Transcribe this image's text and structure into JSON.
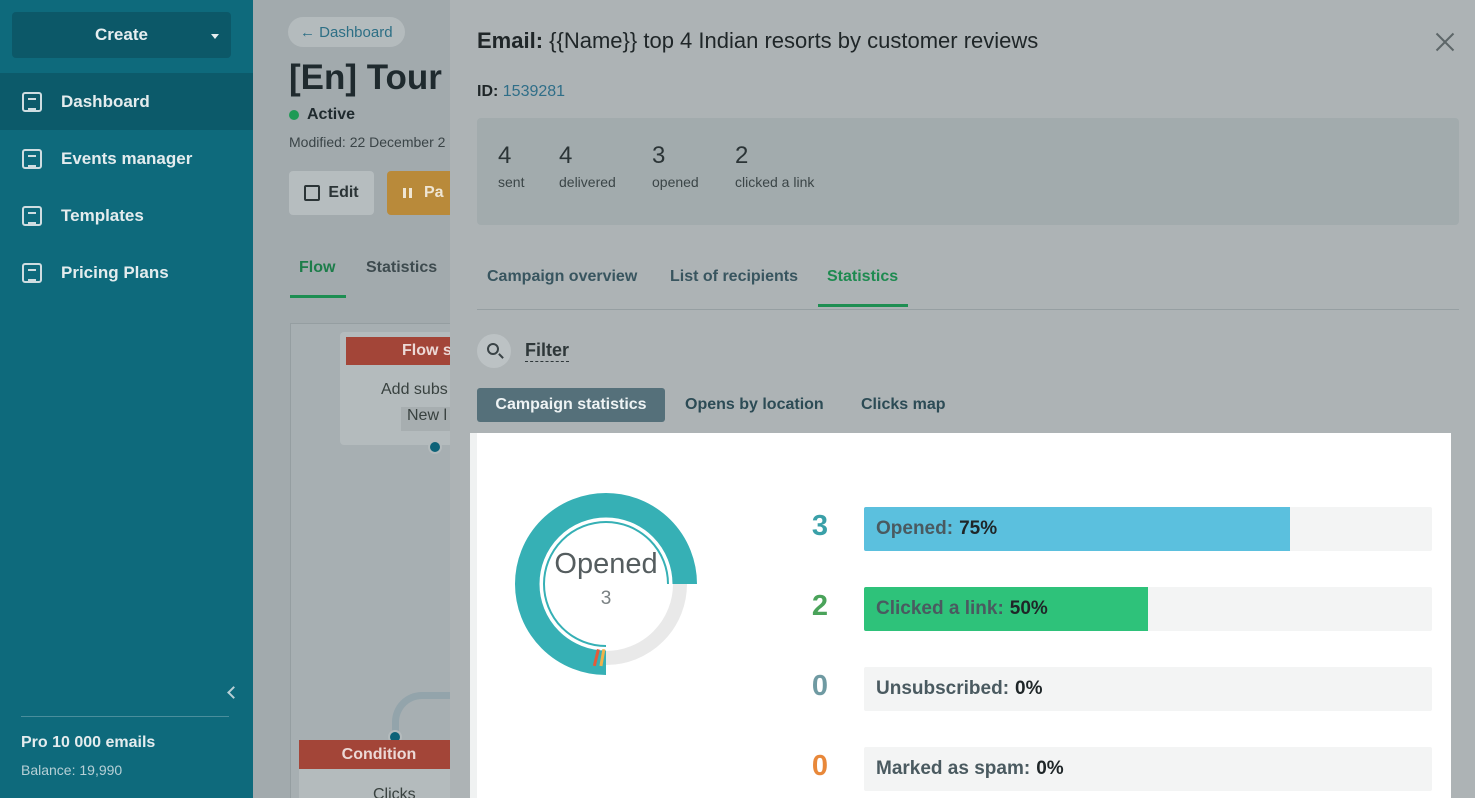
{
  "sidebar": {
    "create_label": "Create",
    "items": [
      {
        "label": "Dashboard",
        "icon": "dashboard-icon"
      },
      {
        "label": "Events manager",
        "icon": "events-icon"
      },
      {
        "label": "Templates",
        "icon": "templates-icon"
      },
      {
        "label": "Pricing Plans",
        "icon": "pricing-icon"
      }
    ],
    "plan": "Pro 10 000 emails",
    "balance": "Balance: 19,990"
  },
  "background_page": {
    "back_link": "← Dashboard",
    "title": "[En] Tour",
    "status": "Active",
    "modified": "Modified: 22 December 2",
    "edit_label": "Edit",
    "pause_label": "Pa",
    "tabs": [
      "Flow",
      "Statistics"
    ],
    "flow": {
      "card_header": "Flow s",
      "card_text": "Add subs",
      "card_tag": "New l",
      "condition_header": "Condition",
      "condition_text": "Clicks"
    }
  },
  "modal": {
    "title_prefix": "Email:",
    "title": "{{Name}} top 4 Indian resorts by customer reviews",
    "id_label": "ID:",
    "id_value": "1539281",
    "summary": [
      {
        "value": "4",
        "label": "sent"
      },
      {
        "value": "4",
        "label": "delivered"
      },
      {
        "value": "3",
        "label": "opened"
      },
      {
        "value": "2",
        "label": "clicked a link"
      }
    ],
    "tabs": [
      "Campaign overview",
      "List of recipients",
      "Statistics"
    ],
    "active_tab": "Statistics",
    "filter_label": "Filter",
    "sub_tabs": [
      "Campaign statistics",
      "Opens by location",
      "Clicks map"
    ],
    "donut": {
      "title": "Opened",
      "value": "3",
      "fraction": 0.75
    },
    "stats": [
      {
        "count": "3",
        "label": "Opened:",
        "percent": "75%",
        "fraction": 0.75,
        "color": "#5bc0de",
        "num_color": "#3aa0a8"
      },
      {
        "count": "2",
        "label": "Clicked a link:",
        "percent": "50%",
        "fraction": 0.5,
        "color": "#2ec27a",
        "num_color": "#4aa35a"
      },
      {
        "count": "0",
        "label": "Unsubscribed:",
        "percent": "0%",
        "fraction": 0,
        "color": "#9aa3a6",
        "num_color": "#6f9aa2"
      },
      {
        "count": "0",
        "label": "Marked as spam:",
        "percent": "0%",
        "fraction": 0,
        "color": "#f08a3c",
        "num_color": "#e8883a"
      }
    ]
  }
}
